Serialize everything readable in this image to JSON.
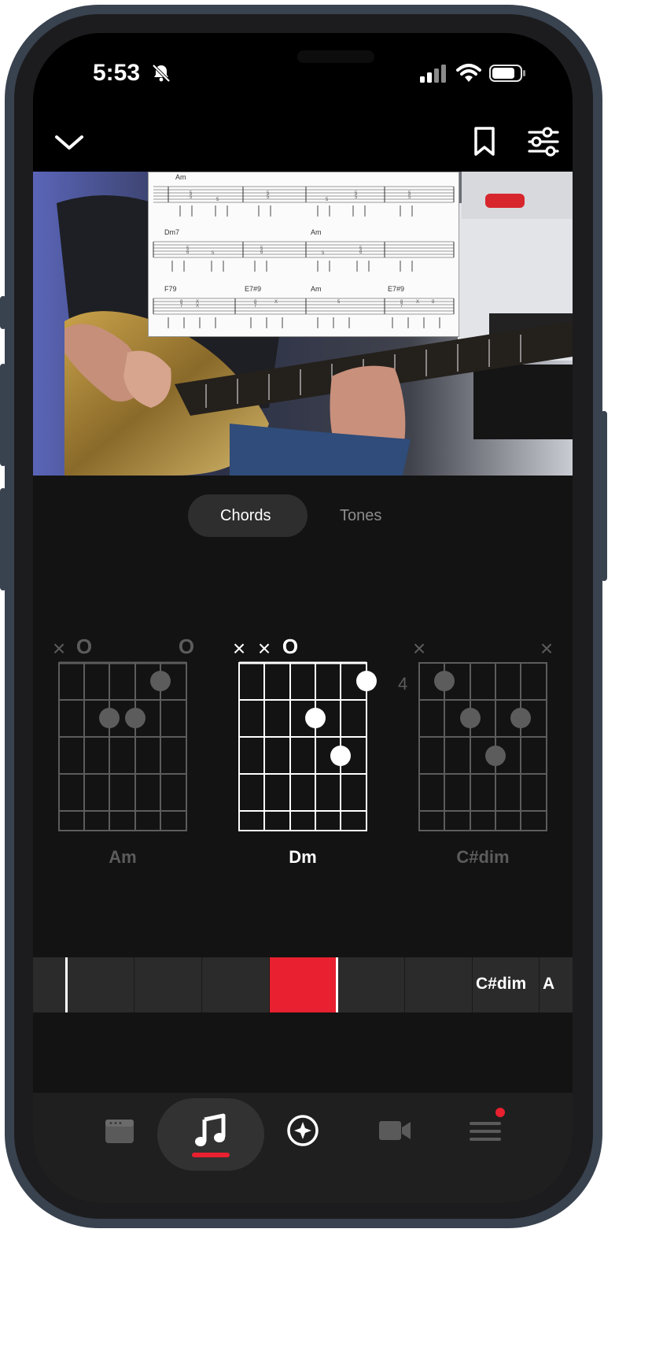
{
  "status_bar": {
    "time": "5:53",
    "icons": [
      "bell-slash-icon",
      "cellular-signal-icon",
      "wifi-icon",
      "battery-icon"
    ]
  },
  "top_bar": {
    "icons": [
      "chevron-down-icon",
      "bookmark-icon",
      "settings-sliders-icon"
    ]
  },
  "video": {
    "tab_chords": [
      "Am",
      "Dm7",
      "Am",
      "F79",
      "E7#9",
      "Am",
      "E7#9"
    ]
  },
  "segmented_control": {
    "options": [
      "Chords",
      "Tones"
    ],
    "selected": "Chords"
  },
  "chords": {
    "previous": {
      "name": "Am",
      "strings": [
        "×",
        "O",
        "",
        "",
        "",
        "O"
      ],
      "fret_label": ""
    },
    "current": {
      "name": "Dm",
      "strings": [
        "×",
        "×",
        "O",
        "",
        "",
        ""
      ],
      "fret_label": ""
    },
    "next": {
      "name": "C#dim",
      "strings": [
        "×",
        "",
        "",
        "",
        "",
        "×"
      ],
      "fret_label": "4"
    }
  },
  "timeline": {
    "labels": [
      "C#dim",
      "A"
    ]
  },
  "bottom_nav": {
    "items": [
      "amp-icon",
      "music-note-icon",
      "compass-icon",
      "video-camera-icon",
      "menu-icon"
    ],
    "active": "music-note-icon"
  },
  "colors": {
    "accent": "#e8202f",
    "background": "#131313",
    "frame": "#39424f"
  }
}
